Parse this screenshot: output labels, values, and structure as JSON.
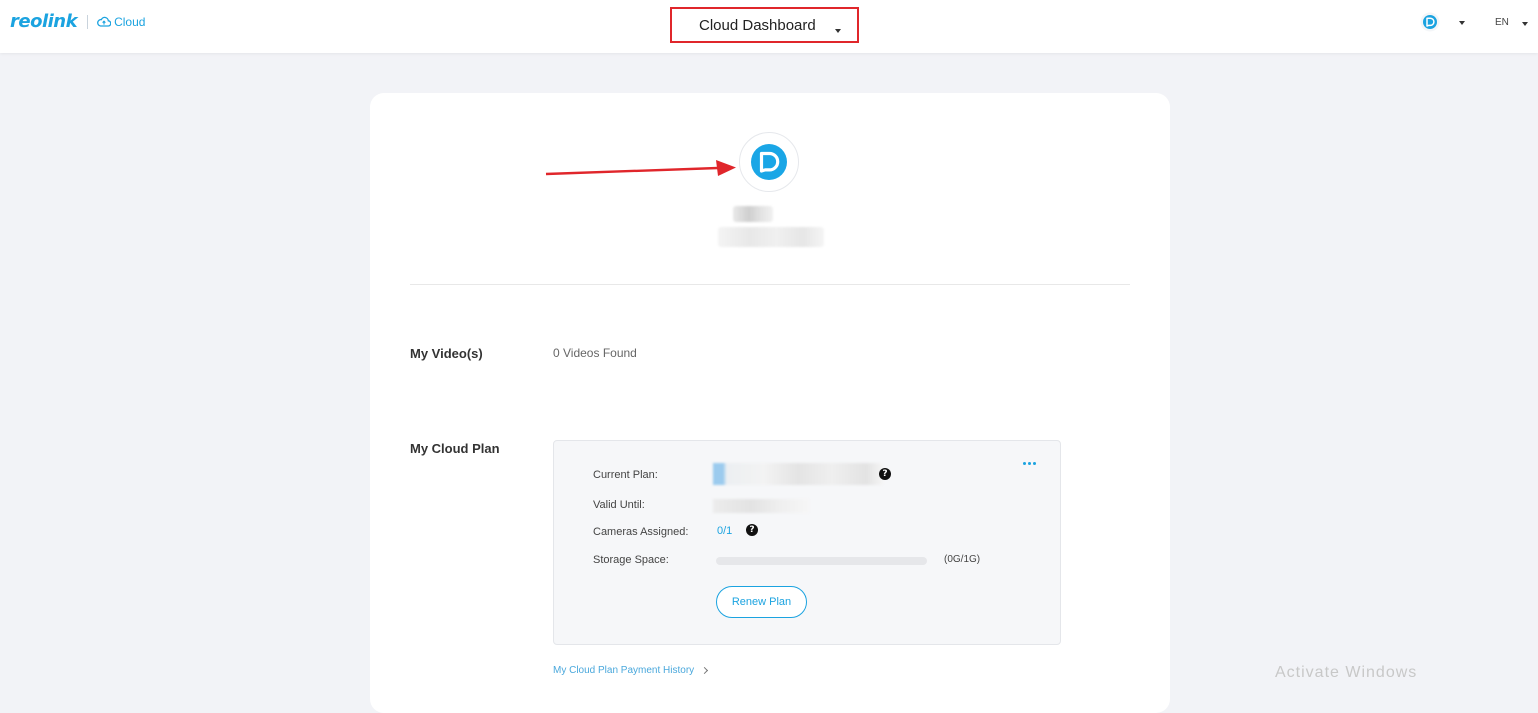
{
  "header": {
    "logo_text": "reolink",
    "product_text": "Cloud",
    "dashboard_select": "Cloud Dashboard",
    "language": "EN"
  },
  "profile": {},
  "videos": {
    "title": "My Video(s)",
    "value": "0 Videos Found"
  },
  "plan": {
    "title": "My Cloud Plan",
    "current_plan_label": "Current Plan:",
    "valid_until_label": "Valid Until:",
    "cameras_label": "Cameras Assigned:",
    "cameras_value": "0/1",
    "storage_label": "Storage Space:",
    "storage_value": "(0G/1G)",
    "storage_used_fraction": 0,
    "renew_button": "Renew Plan",
    "help_glyph": "?",
    "history_link": "My Cloud Plan Payment History"
  },
  "watermark": "Activate Windows",
  "colors": {
    "accent": "#1ba3e0",
    "annotation": "#e0262b",
    "background": "#f2f3f7"
  },
  "icons": [
    "cloud-icon",
    "reolink-r-icon",
    "caret-down-icon",
    "more-icon",
    "help-icon",
    "chevron-right-icon"
  ]
}
